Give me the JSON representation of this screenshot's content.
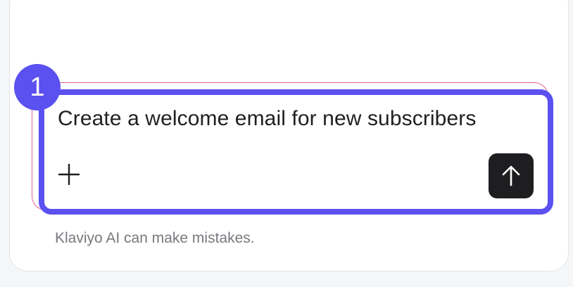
{
  "step_badge": {
    "number": "1"
  },
  "composer": {
    "value": "Create a welcome email for new subscribers",
    "add_icon": "plus-icon",
    "send_icon": "arrow-up-icon"
  },
  "footer": {
    "disclaimer": "Klaviyo AI can make mistakes."
  },
  "colors": {
    "highlight": "#5b50f0",
    "send_button": "#1e1e20",
    "glow_border": "#e0609a"
  }
}
